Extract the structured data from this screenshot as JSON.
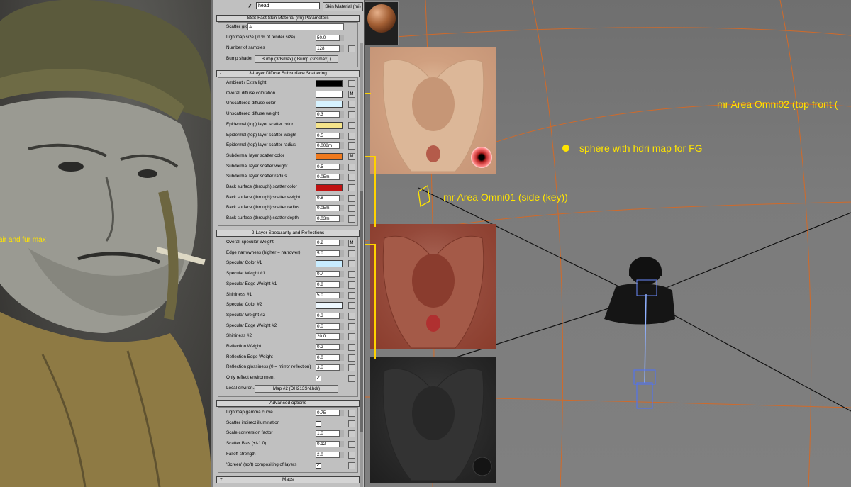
{
  "material": {
    "name": "head",
    "type": "Skin Material (mi)"
  },
  "rollouts": {
    "sss": {
      "sign": "-",
      "title": "SSS Fast Skin Material (mi) Parameters",
      "scatter_group_label": "Scatter group..",
      "scatter_group_value": "A",
      "lightmap_size_label": "Lightmap size (in % of render size)",
      "lightmap_size_value": "50.0",
      "num_samples_label": "Number of samples",
      "num_samples_value": "128",
      "bump_label": "Bump shader",
      "bump_value": "Bump (3dsmax)  ( Bump (3dsmax) )"
    },
    "diffuse": {
      "sign": "-",
      "title": "3-Layer Diffuse Subsurface Scattering",
      "rows": [
        {
          "label": "Ambient / Extra light",
          "kind": "swatch",
          "color": "#000000",
          "m": ""
        },
        {
          "label": "Overall diffuse coloration",
          "kind": "swatch",
          "color": "#ffffff",
          "m": "M"
        },
        {
          "label": "Unscattered diffuse color",
          "kind": "swatch",
          "color": "#d6f2ff",
          "m": ""
        },
        {
          "label": "Unscattered diffuse weight",
          "kind": "num",
          "value": "0.3",
          "m": ""
        },
        {
          "label": "Epidermal (top) layer scatter color",
          "kind": "swatch",
          "color": "#f5e48a",
          "m": ""
        },
        {
          "label": "Epidermal (top) layer scatter weight",
          "kind": "num",
          "value": "0.5",
          "m": ""
        },
        {
          "label": "Epidermal (top) layer scatter radius",
          "kind": "num",
          "value": "0.008m",
          "m": ""
        },
        {
          "label": "Subdermal layer scatter color",
          "kind": "swatch",
          "color": "#f07a1e",
          "m": "M"
        },
        {
          "label": "Subdermal layer scatter weight",
          "kind": "num",
          "value": "0.5",
          "m": ""
        },
        {
          "label": "Subdermal layer scatter radius",
          "kind": "num",
          "value": "0.05m",
          "m": ""
        },
        {
          "label": "Back surface (through) scatter color",
          "kind": "swatch",
          "color": "#c01212",
          "m": ""
        },
        {
          "label": "Back surface (through) scatter weight",
          "kind": "num",
          "value": "0.8",
          "m": ""
        },
        {
          "label": "Back surface (through) scatter radius",
          "kind": "num",
          "value": "0.05m",
          "m": ""
        },
        {
          "label": "Back surface (through) scatter depth",
          "kind": "num",
          "value": "0.03m",
          "m": ""
        }
      ]
    },
    "specular": {
      "sign": "-",
      "title": "2-Layer Specularity and Reflections",
      "rows": [
        {
          "label": "Overall specular Weight",
          "kind": "num",
          "value": "0.2",
          "m": "M"
        },
        {
          "label": "Edge narrowness (higher = narrower)",
          "kind": "num",
          "value": "5.0",
          "m": ""
        },
        {
          "label": "Specular Color #1",
          "kind": "swatch",
          "color": "#c8ecff",
          "m": ""
        },
        {
          "label": "Specular Weight #1",
          "kind": "num",
          "value": "0.7",
          "m": ""
        },
        {
          "label": "Specular Edge Weight #1",
          "kind": "num",
          "value": "0.8",
          "m": ""
        },
        {
          "label": "Shininess #1",
          "kind": "num",
          "value": "5.0",
          "m": ""
        },
        {
          "label": "Specular Color #2",
          "kind": "swatch",
          "color": "#eef8ff",
          "m": ""
        },
        {
          "label": "Specular Weight #2",
          "kind": "num",
          "value": "0.3",
          "m": ""
        },
        {
          "label": "Specular Edge Weight #2",
          "kind": "num",
          "value": "0.0",
          "m": ""
        },
        {
          "label": "Shininess #2",
          "kind": "num",
          "value": "20.0",
          "m": ""
        },
        {
          "label": "Reflection Weight",
          "kind": "num",
          "value": "0.2",
          "m": ""
        },
        {
          "label": "Reflection Edge Weight",
          "kind": "num",
          "value": "0.0",
          "m": ""
        },
        {
          "label": "Reflection glossiness (0 = mirror reflection)",
          "kind": "num",
          "value": "3.0",
          "m": ""
        },
        {
          "label": "Only reflect environment",
          "kind": "check",
          "checked": "✓",
          "m": ""
        }
      ],
      "env_label": "Local environ...",
      "env_value": "Map #2 (DH213SN.hdr)"
    },
    "advanced": {
      "sign": "-",
      "title": "Advanced options",
      "rows": [
        {
          "label": "Lightmap gamma curve",
          "kind": "num",
          "value": "0.75",
          "m": ""
        },
        {
          "label": "Scatter indirect illumination",
          "kind": "check",
          "checked": "",
          "m": ""
        },
        {
          "label": "Scale conversion factor",
          "kind": "num",
          "value": "1.0",
          "m": ""
        },
        {
          "label": "Scatter Bias (+/-1.0)",
          "kind": "num",
          "value": "0.12",
          "m": ""
        },
        {
          "label": "Falloff strength",
          "kind": "num",
          "value": "2.0",
          "m": ""
        },
        {
          "label": "'Screen' (soft) compositing of layers",
          "kind": "check",
          "checked": "✓",
          "m": ""
        }
      ]
    },
    "maps": {
      "sign": "+",
      "title": "Maps"
    }
  },
  "viewport": {
    "labels": {
      "omni02": "mr Area Omni02 (top front (",
      "sphere": "sphere with hdri map for FG",
      "omni01": "mr Area Omni01 (side (key))",
      "hair": "air and fur max"
    },
    "accent_color": "#ffe400",
    "grid_color": "#d06a2a"
  }
}
